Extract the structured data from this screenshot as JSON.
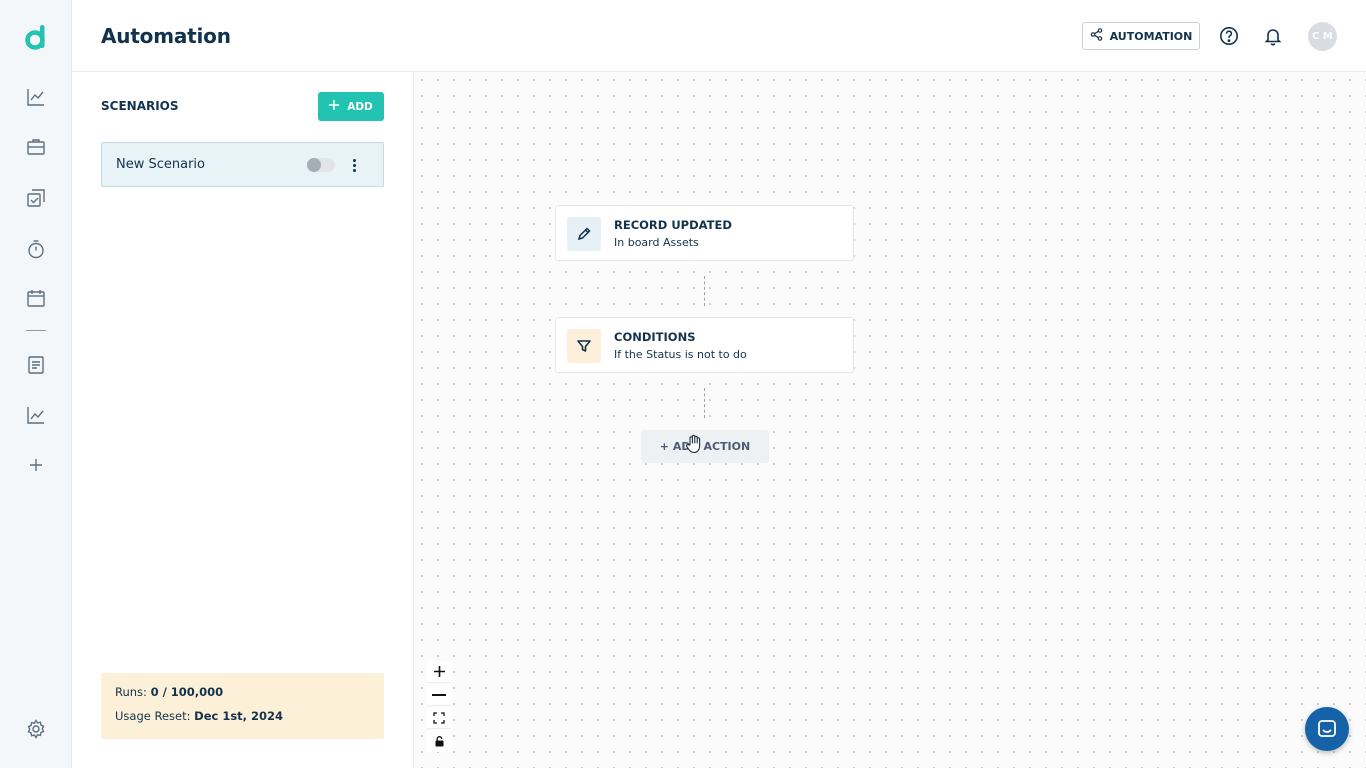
{
  "app": {
    "brand_color": "#22c3b0",
    "logo_icon": "logo-d-icon"
  },
  "rail": {
    "items": [
      {
        "name": "analytics-icon"
      },
      {
        "name": "briefcase-icon"
      },
      {
        "name": "tasks-icon"
      },
      {
        "name": "timer-icon"
      },
      {
        "name": "calendar-icon"
      },
      {
        "name": "document-icon"
      },
      {
        "name": "reports-icon"
      },
      {
        "name": "add-icon"
      },
      {
        "name": "settings-icon"
      }
    ]
  },
  "header": {
    "title": "Automation",
    "automation_button": "AUTOMATION",
    "avatar_initials": "C M"
  },
  "scenarios": {
    "title": "SCENARIOS",
    "add_label": "ADD",
    "items": [
      {
        "name": "New Scenario",
        "enabled": false
      }
    ]
  },
  "usage": {
    "runs_label": "Runs:",
    "runs_value": "0 / 100,000",
    "reset_label": "Usage Reset:",
    "reset_value": "Dec 1st, 2024"
  },
  "flow": {
    "trigger": {
      "title": "RECORD UPDATED",
      "subtitle": "In board Assets",
      "icon": "pencil-icon"
    },
    "condition": {
      "title": "CONDITIONS",
      "subtitle": "If the Status is not to do",
      "icon": "filter-icon"
    },
    "add_action_label": "+ ADD ACTION"
  },
  "canvas_controls": [
    "zoom-in-icon",
    "zoom-out-icon",
    "fit-view-icon",
    "lock-icon"
  ],
  "chat": {
    "icon": "chat-icon"
  }
}
